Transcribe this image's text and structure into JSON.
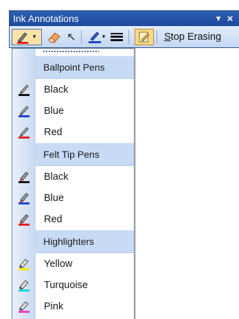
{
  "window": {
    "title": "Ink Annotations",
    "menu_glyph": "▾",
    "close_glyph": "×"
  },
  "toolbar": {
    "pen_dropdown_glyph": "▾",
    "pointer_glyph": "↖",
    "color_dropdown_glyph": "▾",
    "stop_erasing_accesskey": "S",
    "stop_erasing_rest": "top Erasing"
  },
  "menu": {
    "sections": [
      {
        "header": "Ballpoint Pens",
        "items": [
          {
            "label": "Black",
            "color": "#111111",
            "icon": "ballpoint-pen-icon"
          },
          {
            "label": "Blue",
            "color": "#1f3fd6",
            "icon": "ballpoint-pen-icon"
          },
          {
            "label": "Red",
            "color": "#e02020",
            "icon": "ballpoint-pen-icon"
          }
        ]
      },
      {
        "header": "Felt Tip Pens",
        "items": [
          {
            "label": "Black",
            "color": "#111111",
            "icon": "felt-tip-pen-icon"
          },
          {
            "label": "Blue",
            "color": "#1f3fd6",
            "icon": "felt-tip-pen-icon"
          },
          {
            "label": "Red",
            "color": "#e02020",
            "icon": "felt-tip-pen-icon"
          }
        ]
      },
      {
        "header": "Highlighters",
        "items": [
          {
            "label": "Yellow",
            "color": "#f5e600",
            "icon": "highlighter-icon"
          },
          {
            "label": "Turquoise",
            "color": "#19d3d3",
            "icon": "highlighter-icon"
          },
          {
            "label": "Pink",
            "color": "#f03cc8",
            "icon": "highlighter-icon"
          }
        ]
      }
    ]
  },
  "colors": {
    "title_bar": "#1c4a9c",
    "menu_header_bg": "#c8dbf5",
    "active_button_bg": "#fbe3a8"
  }
}
